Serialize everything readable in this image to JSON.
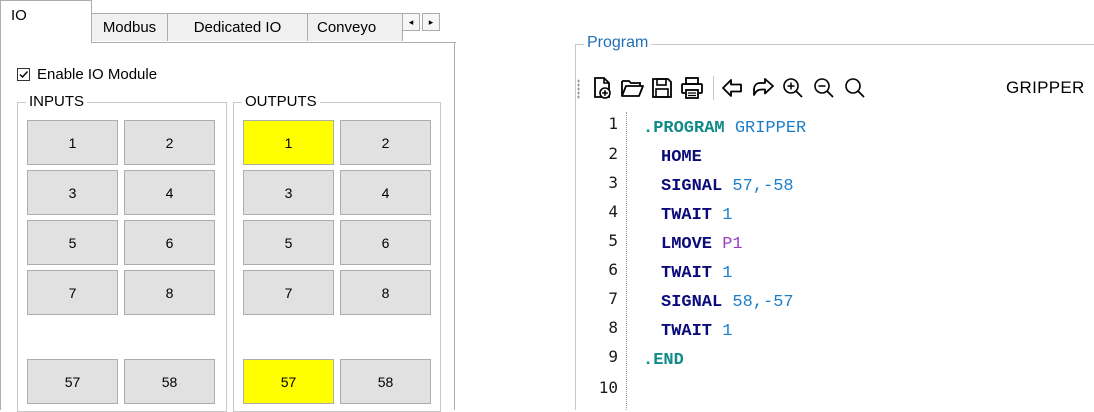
{
  "tabs": {
    "items": [
      {
        "label": "IO",
        "active": true
      },
      {
        "label": "Modbus",
        "active": false
      },
      {
        "label": "Dedicated IO",
        "active": false
      },
      {
        "label": "Conveyo",
        "active": false
      }
    ],
    "scroll_left_glyph": "◂",
    "scroll_right_glyph": "▸"
  },
  "io": {
    "enable_label": "Enable IO Module",
    "enable_checked": true,
    "inputs": {
      "title": "INPUTS",
      "buttons": [
        {
          "label": "1",
          "on": false
        },
        {
          "label": "2",
          "on": false
        },
        {
          "label": "3",
          "on": false
        },
        {
          "label": "4",
          "on": false
        },
        {
          "label": "5",
          "on": false
        },
        {
          "label": "6",
          "on": false
        },
        {
          "label": "7",
          "on": false
        },
        {
          "label": "8",
          "on": false
        },
        {
          "label": "57",
          "on": false
        },
        {
          "label": "58",
          "on": false
        }
      ]
    },
    "outputs": {
      "title": "OUTPUTS",
      "buttons": [
        {
          "label": "1",
          "on": true
        },
        {
          "label": "2",
          "on": false
        },
        {
          "label": "3",
          "on": false
        },
        {
          "label": "4",
          "on": false
        },
        {
          "label": "5",
          "on": false
        },
        {
          "label": "6",
          "on": false
        },
        {
          "label": "7",
          "on": false
        },
        {
          "label": "8",
          "on": false
        },
        {
          "label": "57",
          "on": true
        },
        {
          "label": "58",
          "on": false
        }
      ]
    },
    "on_color": "#ffff00",
    "off_color": "#e1e1e1"
  },
  "program": {
    "title": "Program",
    "toolbar": {
      "icons": [
        "new-file-icon",
        "open-folder-icon",
        "save-icon",
        "print-icon",
        "undo-icon",
        "redo-icon",
        "zoom-in-icon",
        "zoom-out-icon",
        "zoom-reset-icon"
      ],
      "program_name": "GRIPPER"
    },
    "line_numbers": [
      "1",
      "2",
      "3",
      "4",
      "5",
      "6",
      "7",
      "8",
      "9",
      "10"
    ],
    "code": {
      "l1_dir": ".PROGRAM",
      "l1_name": "GRIPPER",
      "l2_kw": "HOME",
      "l3_kw": "SIGNAL",
      "l3_args": "57,-58",
      "l4_kw": "TWAIT",
      "l4_args": "1",
      "l5_kw": "LMOVE",
      "l5_args": "P1",
      "l6_kw": "TWAIT",
      "l6_args": "1",
      "l7_kw": "SIGNAL",
      "l7_args": "58,-57",
      "l8_kw": "TWAIT",
      "l8_args": "1",
      "l9_dir": ".END"
    }
  }
}
